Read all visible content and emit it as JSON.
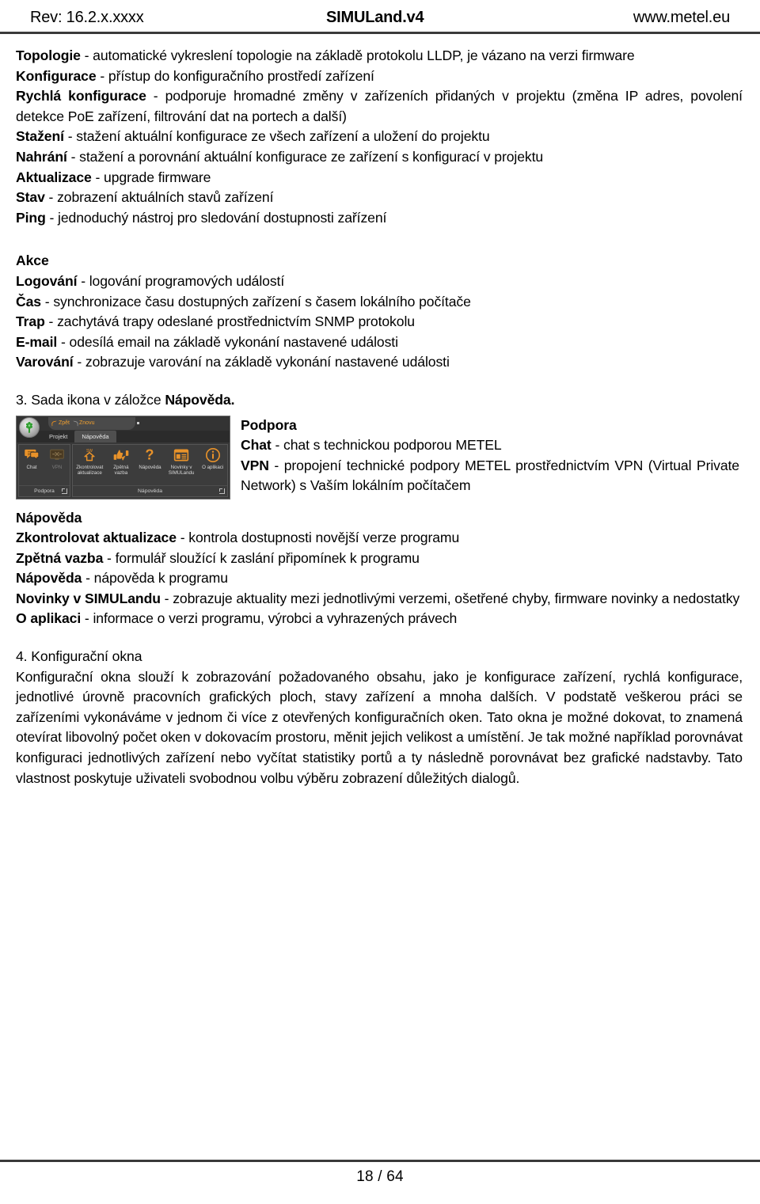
{
  "header": {
    "revision": "Rev: 16.2.x.xxxx",
    "title": "SIMULand.v4",
    "website": "www.metel.eu"
  },
  "feature_list_1": [
    {
      "term": "Topologie",
      "desc": " - automatické vykreslení topologie na základě protokolu LLDP, je vázano na verzi firmware"
    },
    {
      "term": "Konfigurace",
      "desc": " - přístup do konfiguračního prostředí zařízení"
    },
    {
      "term": "Rychlá konfigurace",
      "desc": " - podporuje hromadné změny v zařízeních přidaných v projektu (změna IP adres, povolení detekce PoE zařízení, filtrování dat na portech a další)"
    },
    {
      "term": "Stažení",
      "desc": " - stažení aktuální konfigurace ze všech zařízení a uložení do projektu"
    },
    {
      "term": "Nahrání",
      "desc": " - stažení a porovnání aktuální konfigurace ze zařízení s konfigurací v projektu"
    },
    {
      "term": "Aktualizace",
      "desc": " - upgrade firmware"
    },
    {
      "term": "Stav",
      "desc": " - zobrazení aktuálních stavů zařízení"
    },
    {
      "term": "Ping",
      "desc": " - jednoduchý nástroj pro sledování dostupnosti zařízení"
    }
  ],
  "akce": {
    "heading": "Akce",
    "items": [
      {
        "term": "Logování",
        "desc": " - logování programových událostí"
      },
      {
        "term": "Čas",
        "desc": " - synchronizace času dostupných zařízení s časem lokálního počítače"
      },
      {
        "term": "Trap",
        "desc": " - zachytává trapy odeslané prostřednictvím SNMP protokolu"
      },
      {
        "term": "E-mail",
        "desc": " - odesílá email na základě vykonání nastavené události"
      },
      {
        "term": "Varování",
        "desc": " - zobrazuje varování na základě vykonání nastavené události"
      }
    ]
  },
  "section3": {
    "number_text": "3. Sada ikona v záložce ",
    "bold_tail": "Nápověda."
  },
  "ribbon": {
    "quick_access": [
      {
        "label": "Zpět",
        "icon": "undo-icon"
      },
      {
        "label": "Znovu",
        "icon": "redo-icon"
      }
    ],
    "tabs": [
      {
        "label": "Projekt",
        "active": false
      },
      {
        "label": "Nápověda",
        "active": true
      }
    ],
    "groups": [
      {
        "title": "Podpora",
        "buttons": [
          {
            "label": "Chat",
            "icon": "chat-bubble-icon",
            "disabled": false
          },
          {
            "label": "VPN",
            "icon": "vpn-monitor-icon",
            "disabled": true
          }
        ]
      },
      {
        "title": "Nápověda",
        "buttons": [
          {
            "label": "Zkontrolovat aktualizace",
            "icon": "sw-update-icon",
            "disabled": false
          },
          {
            "label": "Zpětná vazba",
            "icon": "thumbs-feedback-icon",
            "disabled": false
          },
          {
            "label": "Nápověda",
            "icon": "question-mark-icon",
            "disabled": false
          },
          {
            "label": "Novinky v SIMULandu",
            "icon": "news-window-icon",
            "disabled": false
          },
          {
            "label": "O aplikaci",
            "icon": "info-circle-icon",
            "disabled": false
          }
        ]
      }
    ],
    "accent_color": "#E8922A",
    "background_color": "#383838"
  },
  "podpora": {
    "heading": "Podpora",
    "items": [
      {
        "term": "Chat",
        "desc": " - chat s technickou podporou METEL"
      },
      {
        "term": "VPN",
        "desc": " - propojení technické podpory METEL prostřednictvím VPN (Virtual Private Network) s Vaším  lokálním počítačem"
      }
    ]
  },
  "napoveda": {
    "heading": "Nápověda",
    "items": [
      {
        "term": "Zkontrolovat aktualizace",
        "desc": " - kontrola dostupnosti novější verze programu"
      },
      {
        "term": "Zpětná vazba",
        "desc": " - formulář sloužící k zaslání připomínek k programu"
      },
      {
        "term": "Nápověda",
        "desc": " - nápověda k programu"
      },
      {
        "term": "Novinky v SIMULandu",
        "desc": " - zobrazuje aktuality mezi jednotlivými verzemi, ošetřené chyby, firmware novinky a nedostatky"
      },
      {
        "term": "O aplikaci",
        "desc": " - informace o verzi programu, výrobci a vyhrazených právech"
      }
    ]
  },
  "section4": {
    "heading": "4. Konfigurační okna",
    "paragraph": "Konfigurační okna slouží k zobrazování požadovaného obsahu, jako je konfigurace zařízení, rychlá konfigurace, jednotlivé úrovně pracovních grafických ploch, stavy zařízení a mnoha dalších. V podstatě veškerou práci se zařízeními vykonáváme v jednom či více z otevřených konfiguračních oken. Tato okna je možné dokovat, to znamená otevírat libovolný počet oken v dokovacím prostoru, měnit jejich velikost a umístění. Je tak možné například porovnávat konfiguraci jednotlivých zařízení nebo vyčítat statistiky portů a ty následně porovnávat bez grafické nadstavby. Tato vlastnost poskytuje uživateli svobodnou volbu výběru zobrazení důležitých dialogů."
  },
  "footer": {
    "page": "18 / 64"
  }
}
